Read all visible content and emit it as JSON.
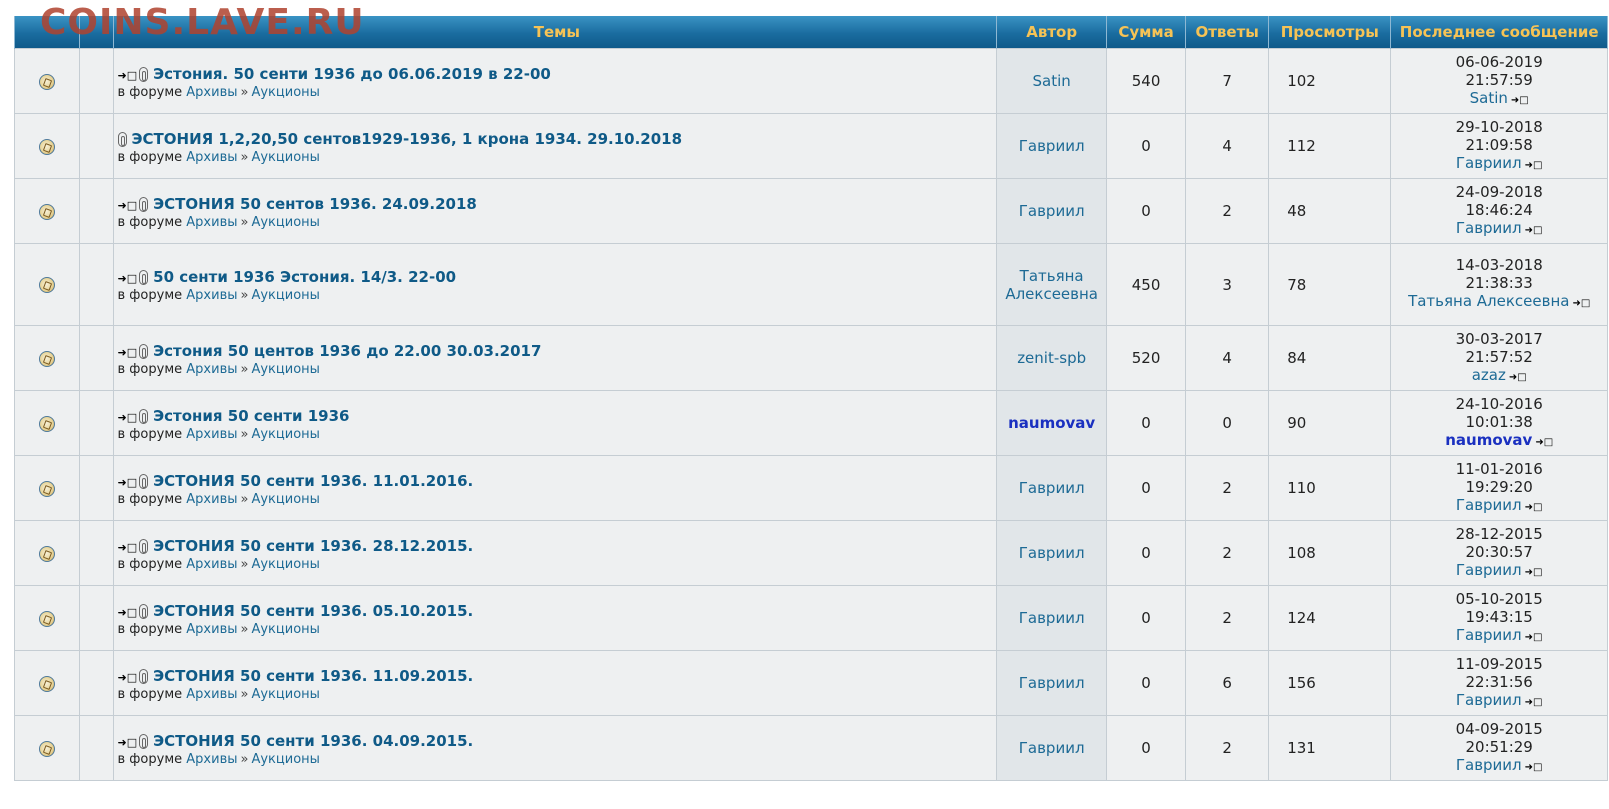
{
  "watermark": "COINS.LAVE.RU",
  "headers": {
    "topics": "Темы",
    "author": "Автор",
    "sum": "Сумма",
    "replies": "Ответы",
    "views": "Просмотры",
    "last": "Последнее сообщение"
  },
  "forum_prefix": "в форуме",
  "forum_path": [
    "Архивы",
    "Аукционы"
  ],
  "rows": [
    {
      "title": "Эстония. 50 сенти 1936 до 06.06.2019 в 22-00",
      "author": "Satin",
      "sum": "540",
      "replies": "7",
      "views": "102",
      "date": "06-06-2019",
      "time": "21:57:59",
      "last_author": "Satin",
      "arrow": true,
      "height": 65
    },
    {
      "title": "ЭСТОНИЯ 1,2,20,50 сентов1929-1936, 1 крона 1934. 29.10.2018",
      "author": "Гавриил",
      "sum": "0",
      "replies": "4",
      "views": "112",
      "date": "29-10-2018",
      "time": "21:09:58",
      "last_author": "Гавриил",
      "arrow": false,
      "height": 65
    },
    {
      "title": "ЭСТОНИЯ 50 сентов 1936. 24.09.2018",
      "author": "Гавриил",
      "sum": "0",
      "replies": "2",
      "views": "48",
      "date": "24-09-2018",
      "time": "18:46:24",
      "last_author": "Гавриил",
      "arrow": true,
      "height": 65
    },
    {
      "title": "50 сенти 1936 Эстония. 14/3. 22-00",
      "author": "Татьяна Алексеевна",
      "sum": "450",
      "replies": "3",
      "views": "78",
      "date": "14-03-2018",
      "time": "21:38:33",
      "last_author": "Татьяна Алексеевна",
      "arrow": true,
      "height": 82
    },
    {
      "title": "Эстония 50 центов 1936 до 22.00 30.03.2017",
      "author": "zenit-spb",
      "sum": "520",
      "replies": "4",
      "views": "84",
      "date": "30-03-2017",
      "time": "21:57:52",
      "last_author": "azaz",
      "arrow": true,
      "height": 65
    },
    {
      "title": "Эстония 50 сенти 1936",
      "author": "naumovav",
      "sum": "0",
      "replies": "0",
      "views": "90",
      "date": "24-10-2016",
      "time": "10:01:38",
      "last_author": "naumovav",
      "arrow": true,
      "height": 65,
      "bold": true
    },
    {
      "title": "ЭСТОНИЯ 50 сенти 1936. 11.01.2016.",
      "author": "Гавриил",
      "sum": "0",
      "replies": "2",
      "views": "110",
      "date": "11-01-2016",
      "time": "19:29:20",
      "last_author": "Гавриил",
      "arrow": true,
      "height": 65
    },
    {
      "title": "ЭСТОНИЯ 50 сенти 1936. 28.12.2015.",
      "author": "Гавриил",
      "sum": "0",
      "replies": "2",
      "views": "108",
      "date": "28-12-2015",
      "time": "20:30:57",
      "last_author": "Гавриил",
      "arrow": true,
      "height": 65
    },
    {
      "title": "ЭСТОНИЯ 50 сенти 1936. 05.10.2015.",
      "author": "Гавриил",
      "sum": "0",
      "replies": "2",
      "views": "124",
      "date": "05-10-2015",
      "time": "19:43:15",
      "last_author": "Гавриил",
      "arrow": true,
      "height": 65
    },
    {
      "title": "ЭСТОНИЯ 50 сенти 1936. 11.09.2015.",
      "author": "Гавриил",
      "sum": "0",
      "replies": "6",
      "views": "156",
      "date": "11-09-2015",
      "time": "22:31:56",
      "last_author": "Гавриил",
      "arrow": true,
      "height": 65
    },
    {
      "title": "ЭСТОНИЯ 50 сенти 1936. 04.09.2015.",
      "author": "Гавриил",
      "sum": "0",
      "replies": "2",
      "views": "131",
      "date": "04-09-2015",
      "time": "20:51:29",
      "last_author": "Гавриил",
      "arrow": true,
      "height": 65
    }
  ]
}
